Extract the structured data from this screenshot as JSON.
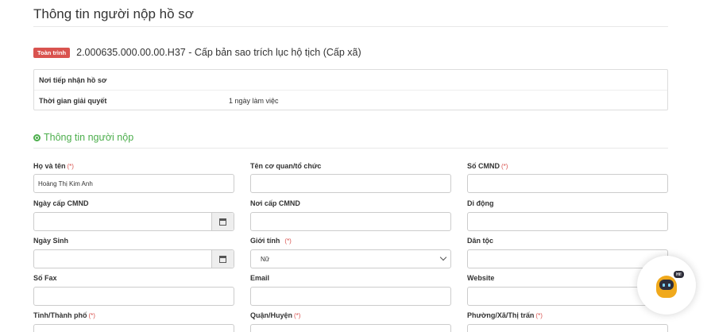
{
  "page": {
    "title": "Thông tin người nộp hồ sơ"
  },
  "procedure": {
    "badge": "Toàn trình",
    "badge_color": "#d9534f",
    "title": "2.000635.000.00.00.H37 - Cấp bản sao trích lục hộ tịch (Cấp xã)"
  },
  "info": {
    "receiver_label": "Nơi tiếp nhận hồ sơ",
    "receiver_value": "",
    "duration_label": "Thời gian giải quyết",
    "duration_value": "1 ngày làm việc"
  },
  "section": {
    "title": "Thông tin người nộp",
    "icon": "globe-icon",
    "color": "#4cae4c"
  },
  "required_mark": "(*)",
  "form": {
    "full_name": {
      "label": "Họ và tên",
      "value": "Hoàng Thị Kim Anh"
    },
    "org_name": {
      "label": "Tên cơ quan/tổ chức",
      "value": ""
    },
    "id_number": {
      "label": "Số CMND",
      "value": ""
    },
    "id_issue_date": {
      "label": "Ngày cấp CMND",
      "value": ""
    },
    "id_issue_place": {
      "label": "Nơi cấp CMND",
      "value": ""
    },
    "mobile": {
      "label": "Di động",
      "value": ""
    },
    "birth_date": {
      "label": "Ngày Sinh",
      "value": ""
    },
    "gender": {
      "label": "Giới tính",
      "value": "Nữ"
    },
    "ethnicity": {
      "label": "Dân tộc",
      "value": ""
    },
    "fax": {
      "label": "Số Fax",
      "value": ""
    },
    "email": {
      "label": "Email",
      "value": ""
    },
    "website": {
      "label": "Website",
      "value": ""
    },
    "province": {
      "label": "Tỉnh/Thành phố"
    },
    "district": {
      "label": "Quận/Huyện"
    },
    "ward": {
      "label": "Phường/Xã/Thị trấn"
    }
  },
  "chatbot": {
    "badge": "Hi!",
    "icon": "chatbot-icon"
  }
}
